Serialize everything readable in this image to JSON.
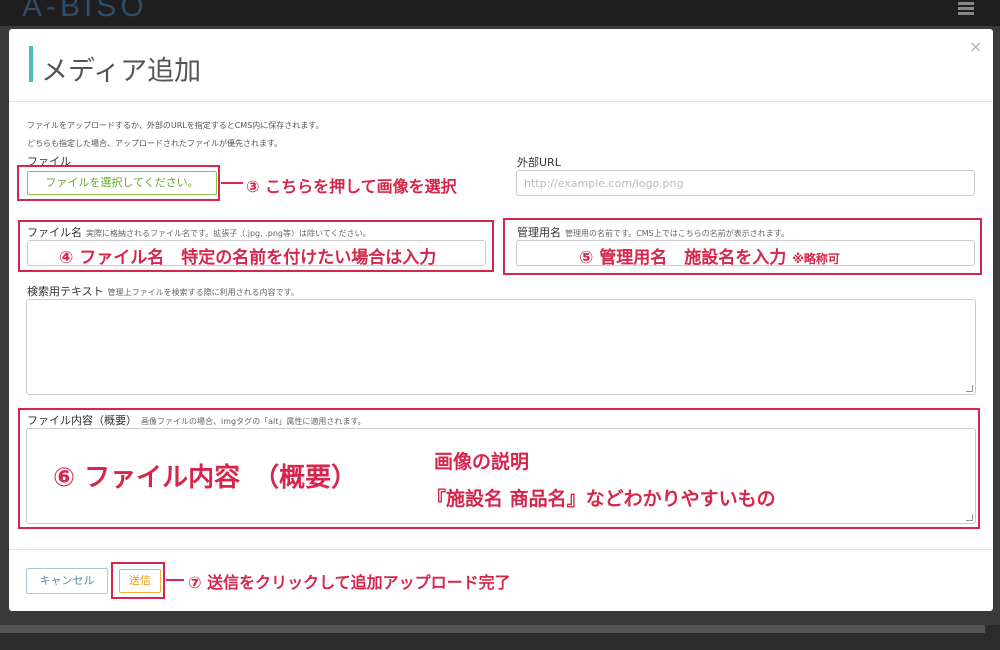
{
  "background": {
    "logo": "A-BISO",
    "menu_icon": "hamburger-icon"
  },
  "modal": {
    "title": "メディア追加",
    "close_icon": "×",
    "help_line1": "ファイルをアップロードするか、外部のURLを指定するとCMS内に保存されます。",
    "help_line2": "どちらも指定した場合、アップロードされたファイルが優先されます。"
  },
  "form": {
    "file_label": "ファイル",
    "file_button": "ファイルを選択してください。",
    "external_url_label": "外部URL",
    "external_url_placeholder": "http://example.com/logo.png",
    "filename_label": "ファイル名",
    "filename_help": "実際に格納されるファイル名です。拡張子（.jpg, .png等）は除いてください。",
    "manage_name_label": "管理用名",
    "manage_name_help": "管理用の名前です。CMS上ではこちらの名前が表示されます。",
    "search_text_label": "検索用テキスト",
    "search_text_help": "管理上ファイルを検索する際に利用される内容です。",
    "content_label": "ファイル内容（概要）",
    "content_help": "画像ファイルの場合、imgタグの「alt」属性に適用されます。"
  },
  "footer": {
    "cancel": "キャンセル",
    "submit": "送信"
  },
  "annotations": {
    "step3": "③ こちらを押して画像を選択",
    "step4": "④ ファイル名　特定の名前を付けたい場合は入力",
    "step5_main": "⑤ 管理用名　施設名を入力",
    "step5_note": "※略称可",
    "step6_main": "⑥ ファイル内容　（概要）",
    "step6_line1": "画像の説明",
    "step6_line2": "『施設名 商品名』などわかりやすいもの",
    "step7": "⑦ 送信をクリックして追加アップロード完了"
  },
  "colors": {
    "accent": "#4fb7bd",
    "annotation": "#d6264b",
    "file_button": "#8cc34a",
    "submit_button": "#f0b040",
    "cancel_button": "#5a8bb0"
  }
}
